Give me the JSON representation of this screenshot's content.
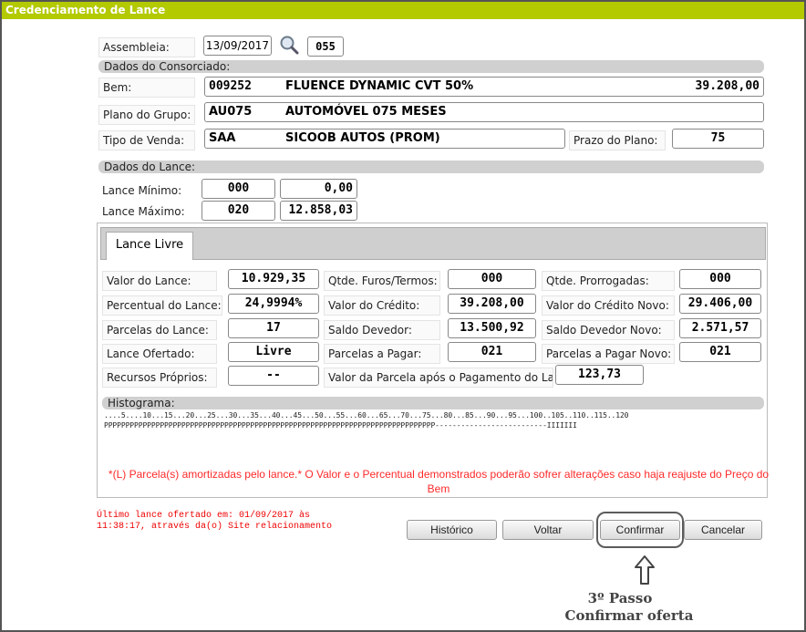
{
  "title": "Credenciamento de Lance",
  "header": {
    "assembleia_label": "Assembleia:",
    "assembleia_date": "13/09/2017",
    "assembleia_num": "055"
  },
  "consorciado": {
    "section": "Dados do Consorciado:",
    "bem_label": "Bem:",
    "bem_code": "009252",
    "bem_name": "FLUENCE DYNAMIC CVT 50%",
    "bem_value": "39.208,00",
    "plano_label": "Plano do Grupo:",
    "plano_code": "AU075",
    "plano_name": "AUTOMÓVEL 075 MESES",
    "tipo_label": "Tipo de Venda:",
    "tipo_code": "SAA",
    "tipo_name": "SICOOB AUTOS (PROM)",
    "prazo_label": "Prazo do Plano:",
    "prazo_value": "75"
  },
  "lance": {
    "section": "Dados do Lance:",
    "minimo_label": "Lance Mínimo:",
    "minimo_num": "000",
    "minimo_value": "0,00",
    "maximo_label": "Lance Máximo:",
    "maximo_num": "020",
    "maximo_value": "12.858,03"
  },
  "tab": {
    "label": "Lance Livre"
  },
  "fields": {
    "valor_lance_label": "Valor do Lance:",
    "valor_lance": "10.929,35",
    "percentual_label": "Percentual do Lance:",
    "percentual": "24,9994%",
    "parcelas_lance_label": "Parcelas do Lance:",
    "parcelas_lance": "17",
    "lance_ofertado_label": "Lance Ofertado:",
    "lance_ofertado": "Livre",
    "recursos_label": "Recursos Próprios:",
    "recursos": "--",
    "furos_label": "Qtde. Furos/Termos:",
    "furos": "000",
    "valor_credito_label": "Valor do Crédito:",
    "valor_credito": "39.208,00",
    "saldo_label": "Saldo Devedor:",
    "saldo": "13.500,92",
    "parcelas_pagar_label": "Parcelas a Pagar:",
    "parcelas_pagar": "021",
    "valor_parcela_label": "Valor da Parcela após o Pagamento do Lan",
    "valor_parcela": "123,73",
    "prorrogadas_label": "Qtde. Prorrogadas:",
    "prorrogadas": "000",
    "credito_novo_label": "Valor do Crédito Novo:",
    "credito_novo": "29.406,00",
    "saldo_novo_label": "Saldo Devedor Novo:",
    "saldo_novo": "2.571,57",
    "parcelas_novo_label": "Parcelas a Pagar Novo:",
    "parcelas_novo": "021"
  },
  "histograma": {
    "label": "Histograma:",
    "scale": "....5....10...15...20...25...30...35...40...45...50...55...60...65...70...75...80...85...90...95...100..105..110..115..120",
    "bars": "PPPPPPPPPPPPPPPPPPPPPPPPPPPPPPPPPPPPPPPPPPPPPPPPPPPPPPPPPPPPPPPPPPPPPPPPPPPPP--------------------------IIIIIII"
  },
  "notice": "*(L) Parcela(s) amortizadas pelo lance.* O Valor e o Percentual demonstrados poderão sofrer alterações caso haja reajuste do Preço do Bem",
  "last_offer": "Último lance ofertado em: 01/09/2017 às\n11:38:17, através da(o) Site relacionamento",
  "buttons": {
    "historico": "Histórico",
    "voltar": "Voltar",
    "confirmar": "Confirmar",
    "cancelar": "Cancelar"
  },
  "annotation": {
    "line1": "3º Passo",
    "line2": "Confirmar oferta"
  },
  "colors": {
    "titlebar": "#b3c900",
    "notice": "#ff2a2a",
    "highlight": "#555555"
  }
}
